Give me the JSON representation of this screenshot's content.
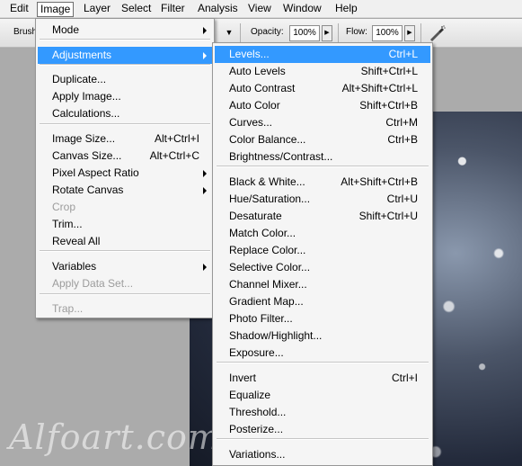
{
  "menubar": {
    "items": [
      "Edit",
      "Image",
      "Layer",
      "Select",
      "Filter",
      "Analysis",
      "View",
      "Window",
      "Help"
    ],
    "active": "Image"
  },
  "options": {
    "brush_label": "Brush",
    "opacity_label": "Opacity:",
    "opacity_value": "100%",
    "flow_label": "Flow:",
    "flow_value": "100%"
  },
  "image_menu": {
    "items": [
      {
        "label": "Mode",
        "submenu": true
      },
      {
        "label": "Adjustments",
        "submenu": true,
        "highlighted": true
      },
      {
        "label": "Duplicate..."
      },
      {
        "label": "Apply Image..."
      },
      {
        "label": "Calculations..."
      },
      {
        "label": "Image Size...",
        "shortcut": "Alt+Ctrl+I"
      },
      {
        "label": "Canvas Size...",
        "shortcut": "Alt+Ctrl+C"
      },
      {
        "label": "Pixel Aspect Ratio",
        "submenu": true
      },
      {
        "label": "Rotate Canvas",
        "submenu": true
      },
      {
        "label": "Crop",
        "disabled": true
      },
      {
        "label": "Trim..."
      },
      {
        "label": "Reveal All"
      },
      {
        "label": "Variables",
        "submenu": true
      },
      {
        "label": "Apply Data Set...",
        "disabled": true
      },
      {
        "label": "Trap...",
        "disabled": true
      }
    ]
  },
  "adjustments_menu": {
    "items": [
      {
        "label": "Levels...",
        "shortcut": "Ctrl+L",
        "highlighted": true
      },
      {
        "label": "Auto Levels",
        "shortcut": "Shift+Ctrl+L"
      },
      {
        "label": "Auto Contrast",
        "shortcut": "Alt+Shift+Ctrl+L"
      },
      {
        "label": "Auto Color",
        "shortcut": "Shift+Ctrl+B"
      },
      {
        "label": "Curves...",
        "shortcut": "Ctrl+M"
      },
      {
        "label": "Color Balance...",
        "shortcut": "Ctrl+B"
      },
      {
        "label": "Brightness/Contrast..."
      },
      {
        "label": "Black & White...",
        "shortcut": "Alt+Shift+Ctrl+B"
      },
      {
        "label": "Hue/Saturation...",
        "shortcut": "Ctrl+U"
      },
      {
        "label": "Desaturate",
        "shortcut": "Shift+Ctrl+U"
      },
      {
        "label": "Match Color..."
      },
      {
        "label": "Replace Color..."
      },
      {
        "label": "Selective Color..."
      },
      {
        "label": "Channel Mixer..."
      },
      {
        "label": "Gradient Map..."
      },
      {
        "label": "Photo Filter..."
      },
      {
        "label": "Shadow/Highlight..."
      },
      {
        "label": "Exposure..."
      },
      {
        "label": "Invert",
        "shortcut": "Ctrl+I"
      },
      {
        "label": "Equalize"
      },
      {
        "label": "Threshold..."
      },
      {
        "label": "Posterize..."
      },
      {
        "label": "Variations..."
      }
    ]
  },
  "watermark": "Alfoart.com",
  "colors": {
    "highlight": "#3399ff",
    "menu_bg": "#f5f5f5",
    "disabled": "#9c9c9c"
  }
}
